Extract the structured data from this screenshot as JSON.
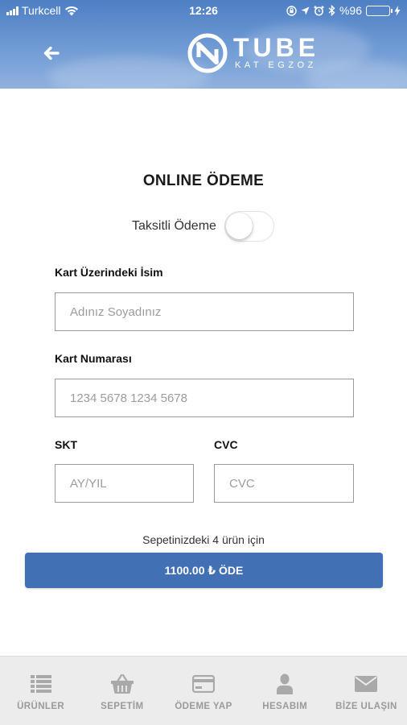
{
  "status_bar": {
    "carrier": "Turkcell",
    "time": "12:26",
    "battery_percent": "%96",
    "battery_level": 0.96
  },
  "header": {
    "logo_title": "TUBE",
    "logo_subtitle": "KAT EGZOZ"
  },
  "form": {
    "title": "ONLINE ÖDEME",
    "installment_label": "Taksitli Ödeme",
    "installment_enabled": false,
    "card_name": {
      "label": "Kart Üzerindeki İsim",
      "placeholder": "Adınız Soyadınız",
      "value": ""
    },
    "card_number": {
      "label": "Kart Numarası",
      "placeholder": "1234 5678 1234 5678",
      "value": ""
    },
    "expiry": {
      "label": "SKT",
      "placeholder": "AY/YIL",
      "value": ""
    },
    "cvc": {
      "label": "CVC",
      "placeholder": "CVC",
      "value": ""
    },
    "cart_info": "Sepetinizdeki 4 ürün için",
    "pay_button": "1100.00 ₺ ÖDE"
  },
  "tabs": [
    {
      "label": "ÜRÜNLER",
      "icon": "list-icon"
    },
    {
      "label": "SEPETİM",
      "icon": "basket-icon"
    },
    {
      "label": "ÖDEME YAP",
      "icon": "credit-card-icon"
    },
    {
      "label": "HESABIM",
      "icon": "user-icon"
    },
    {
      "label": "BİZE ULAŞIN",
      "icon": "envelope-icon"
    }
  ],
  "colors": {
    "header_blue": "#4d7fc4",
    "pay_button": "#4270b4",
    "tab_inactive": "#9a9a9a",
    "battery_green": "#4cd964"
  }
}
